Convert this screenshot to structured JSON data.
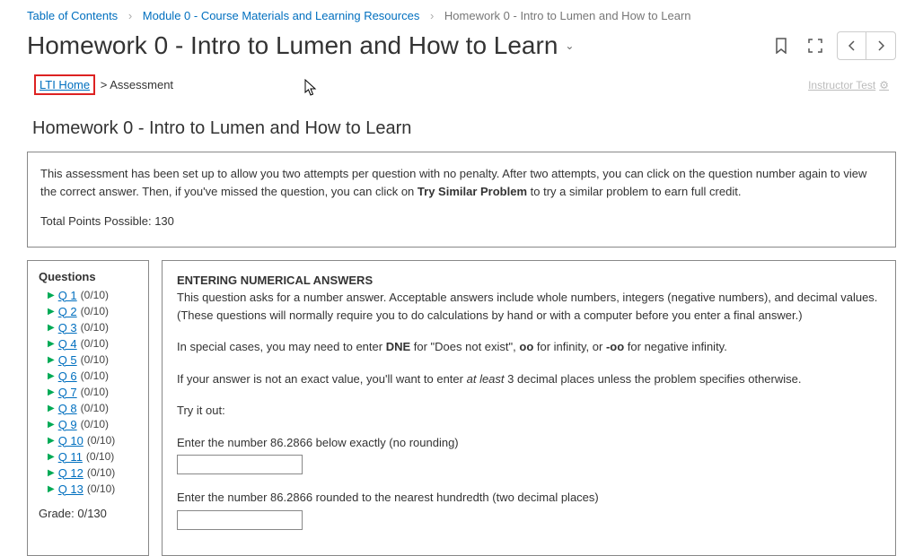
{
  "breadcrumb": {
    "toc": "Table of Contents",
    "module": "Module 0 - Course Materials and Learning Resources",
    "current": "Homework 0 - Intro to Lumen and How to Learn"
  },
  "page_title": "Homework 0 - Intro to Lumen and How to Learn",
  "sub_breadcrumb": {
    "lti_home": "LTI Home",
    "assessment": "Assessment",
    "instructor": "Instructor Test"
  },
  "section_title": "Homework 0 - Intro to Lumen and How to Learn",
  "info_box": {
    "line1a": "This assessment has been set up to allow you two attempts per question with no penalty.  After two attempts, you can click on the question number again to view the correct answer.  Then, if you've missed the question, you can click on ",
    "line1b": "Try Similar Problem",
    "line1c": " to try a similar problem to earn full credit.",
    "points_label": "Total Points Possible: ",
    "points_value": "130"
  },
  "questions": {
    "header": "Questions",
    "items": [
      {
        "label": "Q 1",
        "pts": "(0/10)"
      },
      {
        "label": "Q 2",
        "pts": "(0/10)"
      },
      {
        "label": "Q 3",
        "pts": "(0/10)"
      },
      {
        "label": "Q 4",
        "pts": "(0/10)"
      },
      {
        "label": "Q 5",
        "pts": "(0/10)"
      },
      {
        "label": "Q 6",
        "pts": "(0/10)"
      },
      {
        "label": "Q 7",
        "pts": "(0/10)"
      },
      {
        "label": "Q 8",
        "pts": "(0/10)"
      },
      {
        "label": "Q 9",
        "pts": "(0/10)"
      },
      {
        "label": "Q 10",
        "pts": "(0/10)"
      },
      {
        "label": "Q 11",
        "pts": "(0/10)"
      },
      {
        "label": "Q 12",
        "pts": "(0/10)"
      },
      {
        "label": "Q 13",
        "pts": "(0/10)"
      }
    ],
    "grade_label": "Grade: ",
    "grade_value": "0/130"
  },
  "question_body": {
    "heading": "ENTERING NUMERICAL ANSWERS",
    "p1": "This question asks for a number answer. Acceptable answers include whole numbers, integers (negative numbers), and decimal values. (These questions will normally require you to do calculations by hand or with a computer before you enter a final answer.)",
    "p2a": "In special cases, you may need to enter ",
    "p2b": "DNE",
    "p2c": " for \"Does not exist\", ",
    "p2d": "oo",
    "p2e": " for infinity, or ",
    "p2f": "-oo",
    "p2g": " for negative infinity.",
    "p3a": "If your answer is not an exact value, you'll want to enter ",
    "p3b": "at least",
    "p3c": " 3 decimal places unless the problem specifies otherwise.",
    "p4": "Try it out:",
    "prompt1": "Enter the number 86.2866 below exactly (no rounding)",
    "prompt2": "Enter the number 86.2866 rounded to the nearest hundredth (two decimal places)"
  }
}
